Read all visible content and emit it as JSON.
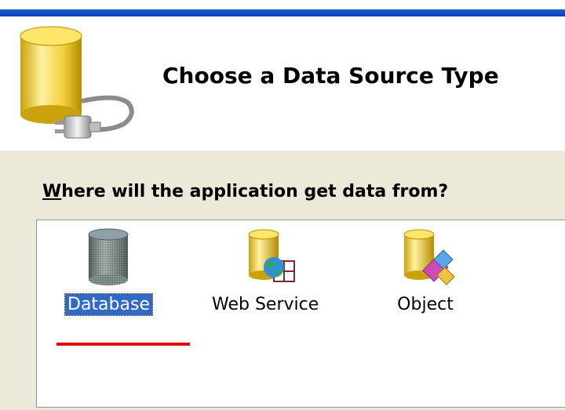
{
  "wizard": {
    "title": "Choose a Data Source Type",
    "header_icon": "database-plug-icon"
  },
  "question": {
    "mnemonic": "W",
    "rest": "here will the application get data from?"
  },
  "sources": [
    {
      "label": "Database",
      "icon": "database-icon",
      "selected": true
    },
    {
      "label": "Web Service",
      "icon": "web-service-icon",
      "selected": false
    },
    {
      "label": "Object",
      "icon": "object-icon",
      "selected": false
    }
  ],
  "colors": {
    "selection": "#316ac5",
    "panel": "#ece9d8",
    "annotation": "#e01010"
  }
}
